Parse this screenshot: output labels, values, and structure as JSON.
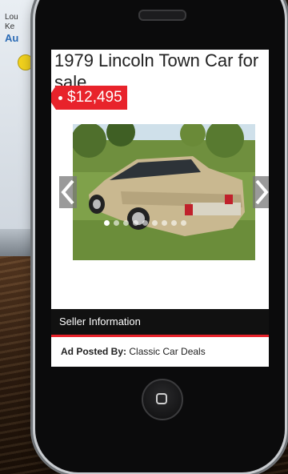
{
  "background": {
    "laptop_line1": "Lou",
    "laptop_line2": "Ke",
    "laptop_line3": "Au"
  },
  "listing": {
    "title": "1979 Lincoln Town Car for sale",
    "price": "$12,495",
    "photo_count": 9,
    "active_photo_index": 0
  },
  "seller": {
    "section_title": "Seller Information",
    "posted_by_label": "Ad Posted By:",
    "posted_by_value": "Classic Car Deals"
  },
  "colors": {
    "accent_red": "#e8232b",
    "bar_black": "#111111"
  },
  "icons": {
    "prev": "chevron-left-icon",
    "next": "chevron-right-icon",
    "home": "home-button-icon"
  }
}
